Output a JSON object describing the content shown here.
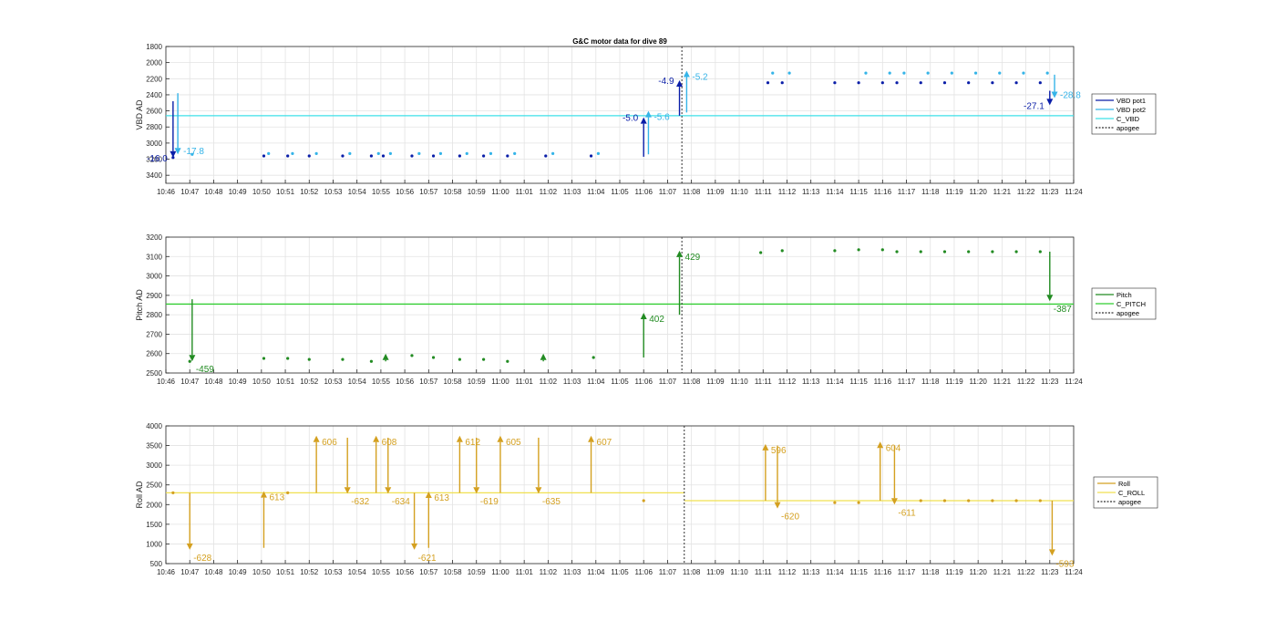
{
  "title": "G&C motor data for dive 89",
  "time_ticks": [
    "10:46",
    "10:47",
    "10:48",
    "10:49",
    "10:50",
    "10:51",
    "10:52",
    "10:53",
    "10:54",
    "10:55",
    "10:56",
    "10:57",
    "10:58",
    "10:59",
    "11:00",
    "11:01",
    "11:02",
    "11:03",
    "11:04",
    "11:05",
    "11:06",
    "11:07",
    "11:08",
    "11:09",
    "11:10",
    "11:11",
    "11:12",
    "11:13",
    "11:14",
    "11:15",
    "11:16",
    "11:17",
    "11:18",
    "11:19",
    "11:20",
    "11:21",
    "11:22",
    "11:23",
    "11:24"
  ],
  "chart_data": [
    {
      "type": "scatter",
      "name": "vbd",
      "ylabel": "VBD AD",
      "xlim": [
        0,
        38
      ],
      "ylim": [
        1800,
        3500
      ],
      "y_reversed": true,
      "yticks": [
        1800,
        2000,
        2200,
        2400,
        2600,
        2800,
        3000,
        3200,
        3400
      ],
      "grid": true,
      "apogee_x": 21.6,
      "legend": [
        "VBD pot1",
        "VBD pot2",
        "C_VBD",
        "apogee"
      ],
      "legend_position": "right",
      "colors": {
        "pot1": "#0a1ea8",
        "pot2": "#35b4e8",
        "c_vbd": "#3fe0e8",
        "apogee": "#303030"
      },
      "c_line": [
        {
          "x0": 0,
          "x1": 38,
          "y": 2660
        }
      ],
      "series": [
        {
          "name": "VBD pot1",
          "points": [
            [
              0.3,
              3180
            ],
            [
              4.1,
              3160
            ],
            [
              5.1,
              3160
            ],
            [
              6.0,
              3160
            ],
            [
              7.4,
              3160
            ],
            [
              8.6,
              3160
            ],
            [
              9.1,
              3160
            ],
            [
              10.3,
              3160
            ],
            [
              11.2,
              3160
            ],
            [
              12.3,
              3160
            ],
            [
              13.3,
              3160
            ],
            [
              14.3,
              3160
            ],
            [
              15.9,
              3160
            ],
            [
              17.8,
              3160
            ],
            [
              25.2,
              2250
            ],
            [
              25.8,
              2250
            ],
            [
              28.0,
              2250
            ],
            [
              29.0,
              2250
            ],
            [
              30.0,
              2250
            ],
            [
              30.6,
              2250
            ],
            [
              31.6,
              2250
            ],
            [
              32.6,
              2250
            ],
            [
              33.6,
              2250
            ],
            [
              34.6,
              2250
            ],
            [
              35.6,
              2250
            ],
            [
              36.6,
              2250
            ]
          ]
        },
        {
          "name": "VBD pot2",
          "points": [
            [
              1.1,
              3140
            ],
            [
              4.3,
              3130
            ],
            [
              5.3,
              3130
            ],
            [
              6.3,
              3130
            ],
            [
              7.7,
              3130
            ],
            [
              8.9,
              3130
            ],
            [
              9.4,
              3130
            ],
            [
              10.6,
              3130
            ],
            [
              11.5,
              3130
            ],
            [
              12.6,
              3130
            ],
            [
              13.6,
              3130
            ],
            [
              14.6,
              3130
            ],
            [
              16.2,
              3130
            ],
            [
              18.1,
              3130
            ],
            [
              25.4,
              2130
            ],
            [
              26.1,
              2130
            ],
            [
              29.3,
              2130
            ],
            [
              30.3,
              2130
            ],
            [
              30.9,
              2130
            ],
            [
              31.9,
              2130
            ],
            [
              32.9,
              2130
            ],
            [
              33.9,
              2130
            ],
            [
              34.9,
              2130
            ],
            [
              35.9,
              2130
            ],
            [
              36.9,
              2130
            ]
          ]
        }
      ],
      "arrows": [
        {
          "series": "VBD pot1",
          "x": 0.3,
          "y_from": 2480,
          "y_to": 3180,
          "label": "-16.0",
          "label_side": "left"
        },
        {
          "series": "VBD pot2",
          "x": 0.5,
          "y_from": 2380,
          "y_to": 3140,
          "label": "-17.8",
          "label_side": "right"
        },
        {
          "series": "VBD pot1",
          "x": 20.0,
          "y_from": 3170,
          "y_to": 2680,
          "label": "-5.0",
          "label_side": "left"
        },
        {
          "series": "VBD pot2",
          "x": 20.2,
          "y_from": 3140,
          "y_to": 2600,
          "label": "-5.6",
          "label_side": "right"
        },
        {
          "series": "VBD pot1",
          "x": 21.5,
          "y_from": 2660,
          "y_to": 2220,
          "label": "-4.9",
          "label_side": "left"
        },
        {
          "series": "VBD pot2",
          "x": 21.8,
          "y_from": 2620,
          "y_to": 2100,
          "label": "-5.2",
          "label_side": "right"
        },
        {
          "series": "VBD pot1",
          "x": 37.0,
          "y_from": 2350,
          "y_to": 2530,
          "label": "-27.1",
          "label_side": "left"
        },
        {
          "series": "VBD pot2",
          "x": 37.2,
          "y_from": 2150,
          "y_to": 2440,
          "label": "-28.8",
          "label_side": "right"
        }
      ]
    },
    {
      "type": "scatter",
      "name": "pitch",
      "ylabel": "Pitch AD",
      "xlim": [
        0,
        38
      ],
      "ylim": [
        2500,
        3200
      ],
      "yticks": [
        2500,
        2600,
        2700,
        2800,
        2900,
        3000,
        3100,
        3200
      ],
      "grid": true,
      "apogee_x": 21.6,
      "legend": [
        "Pitch",
        "C_PITCH",
        "apogee"
      ],
      "legend_position": "right",
      "colors": {
        "pitch": "#228b22",
        "c_pitch": "#32cd32",
        "apogee": "#303030"
      },
      "c_line": [
        {
          "x0": 0,
          "x1": 38,
          "y": 2855
        }
      ],
      "series": [
        {
          "name": "Pitch",
          "points": [
            [
              1.0,
              2560
            ],
            [
              4.1,
              2575
            ],
            [
              5.1,
              2575
            ],
            [
              6.0,
              2570
            ],
            [
              7.4,
              2570
            ],
            [
              8.6,
              2560
            ],
            [
              10.3,
              2590
            ],
            [
              11.2,
              2580
            ],
            [
              12.3,
              2570
            ],
            [
              13.3,
              2570
            ],
            [
              14.3,
              2560
            ],
            [
              17.9,
              2580
            ],
            [
              24.9,
              3120
            ],
            [
              25.8,
              3130
            ],
            [
              28.0,
              3130
            ],
            [
              29.0,
              3135
            ],
            [
              30.0,
              3135
            ],
            [
              30.6,
              3125
            ],
            [
              31.6,
              3125
            ],
            [
              32.6,
              3125
            ],
            [
              33.6,
              3125
            ],
            [
              34.6,
              3125
            ],
            [
              35.6,
              3125
            ],
            [
              36.6,
              3125
            ]
          ]
        }
      ],
      "arrows": [
        {
          "series": "Pitch",
          "x": 1.1,
          "y_from": 2880,
          "y_to": 2560,
          "label": "-459",
          "label_side": "below-right"
        },
        {
          "series": "Pitch",
          "x": 9.2,
          "y_from": 2560,
          "y_to": 2600,
          "label": "",
          "label_side": "none"
        },
        {
          "series": "Pitch",
          "x": 15.8,
          "y_from": 2560,
          "y_to": 2600,
          "label": "",
          "label_side": "none"
        },
        {
          "series": "Pitch",
          "x": 20.0,
          "y_from": 2580,
          "y_to": 2810,
          "label": "402",
          "label_side": "right"
        },
        {
          "series": "Pitch",
          "x": 21.5,
          "y_from": 2800,
          "y_to": 3130,
          "label": "429",
          "label_side": "right"
        },
        {
          "series": "Pitch",
          "x": 37.0,
          "y_from": 3125,
          "y_to": 2870,
          "label": "-387",
          "label_side": "below-right"
        }
      ]
    },
    {
      "type": "scatter",
      "name": "roll",
      "ylabel": "Roll AD",
      "xlim": [
        0,
        38
      ],
      "ylim": [
        500,
        4000
      ],
      "yticks": [
        500,
        1000,
        1500,
        2000,
        2500,
        3000,
        3500,
        4000
      ],
      "grid": true,
      "apogee_x": 21.7,
      "legend": [
        "Roll",
        "C_ROLL",
        "apogee"
      ],
      "legend_position": "right",
      "colors": {
        "roll": "#d4a020",
        "c_roll": "#f0e050",
        "apogee": "#303030"
      },
      "c_line": [
        {
          "x0": 0,
          "x1": 21.7,
          "y": 2300
        },
        {
          "x0": 21.7,
          "x1": 38,
          "y": 2100
        }
      ],
      "series": [
        {
          "name": "Roll",
          "points": [
            [
              0.3,
              2300
            ],
            [
              5.1,
              2300
            ],
            [
              20.0,
              2100
            ],
            [
              28.0,
              2050
            ],
            [
              29.0,
              2050
            ],
            [
              31.6,
              2100
            ],
            [
              32.6,
              2100
            ],
            [
              33.6,
              2100
            ],
            [
              34.6,
              2100
            ],
            [
              35.6,
              2100
            ],
            [
              36.6,
              2100
            ]
          ]
        }
      ],
      "arrows": [
        {
          "series": "Roll",
          "x": 1.0,
          "y_from": 2300,
          "y_to": 850,
          "label": "-628",
          "label_side": "below-right"
        },
        {
          "series": "Roll",
          "x": 4.1,
          "y_from": 900,
          "y_to": 2340,
          "label": "613",
          "label_side": "right"
        },
        {
          "series": "Roll",
          "x": 6.3,
          "y_from": 2300,
          "y_to": 3750,
          "label": "606",
          "label_side": "right"
        },
        {
          "series": "Roll",
          "x": 7.6,
          "y_from": 3700,
          "y_to": 2280,
          "label": "-632",
          "label_side": "below-right"
        },
        {
          "series": "Roll",
          "x": 8.8,
          "y_from": 2300,
          "y_to": 3750,
          "label": "608",
          "label_side": "right"
        },
        {
          "series": "Roll",
          "x": 9.3,
          "y_from": 3700,
          "y_to": 2280,
          "label": "-634",
          "label_side": "below-right"
        },
        {
          "series": "Roll",
          "x": 10.4,
          "y_from": 2300,
          "y_to": 850,
          "label": "-621",
          "label_side": "below-right"
        },
        {
          "series": "Roll",
          "x": 11.0,
          "y_from": 900,
          "y_to": 2330,
          "label": "613",
          "label_side": "right"
        },
        {
          "series": "Roll",
          "x": 12.3,
          "y_from": 2300,
          "y_to": 3750,
          "label": "612",
          "label_side": "right"
        },
        {
          "series": "Roll",
          "x": 13.0,
          "y_from": 3700,
          "y_to": 2280,
          "label": "-619",
          "label_side": "below-right"
        },
        {
          "series": "Roll",
          "x": 14.0,
          "y_from": 2300,
          "y_to": 3750,
          "label": "605",
          "label_side": "right"
        },
        {
          "series": "Roll",
          "x": 15.6,
          "y_from": 3700,
          "y_to": 2280,
          "label": "-635",
          "label_side": "below-right"
        },
        {
          "series": "Roll",
          "x": 17.8,
          "y_from": 2300,
          "y_to": 3750,
          "label": "607",
          "label_side": "right"
        },
        {
          "series": "Roll",
          "x": 25.1,
          "y_from": 2100,
          "y_to": 3540,
          "label": "596",
          "label_side": "right"
        },
        {
          "series": "Roll",
          "x": 25.6,
          "y_from": 3500,
          "y_to": 1900,
          "label": "-620",
          "label_side": "below-right"
        },
        {
          "series": "Roll",
          "x": 29.9,
          "y_from": 2100,
          "y_to": 3600,
          "label": "604",
          "label_side": "right"
        },
        {
          "series": "Roll",
          "x": 30.5,
          "y_from": 3500,
          "y_to": 2000,
          "label": "-611",
          "label_side": "below-right"
        },
        {
          "series": "Roll",
          "x": 37.1,
          "y_from": 2100,
          "y_to": 700,
          "label": "-593",
          "label_side": "below-right"
        }
      ]
    }
  ]
}
